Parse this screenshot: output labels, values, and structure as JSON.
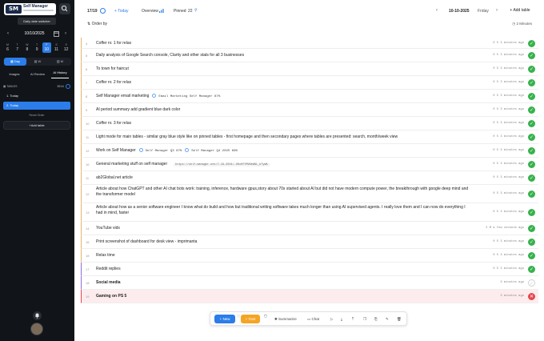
{
  "sidebar": {
    "logo_text": "Self Manager",
    "logo_mark": "SM",
    "tooltip": "Daily date switcher",
    "date": "10/10/2025",
    "days": [
      {
        "dow": "M",
        "num": "6"
      },
      {
        "dow": "T",
        "num": "7"
      },
      {
        "dow": "W",
        "num": "8"
      },
      {
        "dow": "T",
        "num": "9"
      },
      {
        "dow": "F",
        "num": "10"
      },
      {
        "dow": "S",
        "num": "11"
      },
      {
        "dow": "S",
        "num": "12"
      }
    ],
    "selected_day_index": 4,
    "view_tabs": [
      "Day",
      "W",
      "M"
    ],
    "mode_tabs": [
      "Images",
      "AI Review",
      "AI History"
    ],
    "tables_label": "TABLES",
    "tables_count": "38/44",
    "tables": [
      "1. Today",
      "2. Today"
    ],
    "reset_label": "Reset Order",
    "add_table_label": "+Add table"
  },
  "header": {
    "count": "17/19",
    "today": "+ Today",
    "overview": "Overview",
    "pinned_label": "Pinned",
    "pinned_count": "22",
    "date": "10-10-2025",
    "dow": "Friday",
    "add_table": "+ Add table",
    "order_by": "Order by",
    "time_ago": "2 Minutes"
  },
  "rows": [
    {
      "n": "4",
      "title": "Coffer nr. 1 for relax",
      "meta": "0 5   3 minutes ago",
      "status": "done"
    },
    {
      "n": "5",
      "title": "Daily analysis of Google Search console, Clarity and other stats for all 3 businesses",
      "meta": "0 5   3 minutes ago",
      "status": "done"
    },
    {
      "n": "6",
      "title": "To town for haircut",
      "meta": "0 5   3 minutes ago",
      "status": "done"
    },
    {
      "n": "7",
      "title": "Coffer nr. 2 for relax",
      "meta": "0 5   3 minutes ago",
      "status": "done"
    },
    {
      "n": "8",
      "title": "Self Manager email marketing",
      "chip": "Email Marketing Self Manager 87%",
      "meta": "0 5   3 minutes ago",
      "status": "done"
    },
    {
      "n": "9",
      "title": "AI period summary add gradient blue dark color",
      "meta": "0 5   3 minutes ago",
      "status": "done"
    },
    {
      "n": "10",
      "title": "Coffer nr. 3 for relax",
      "meta": "0 5   3 minutes ago",
      "status": "done"
    },
    {
      "n": "11",
      "title": "Light mode for main tables - similar gray blue style like on pinned tables - first homepage and then secondary pages where tables are presented: search, month/week view",
      "meta": "0 5   3 minutes ago",
      "status": "done"
    },
    {
      "n": "12",
      "title": "Work on Self Manager",
      "chip": "Self Manager Q3 67%",
      "chip2": "Self Manager Q4 2025 69%",
      "meta": "0 5   3 minutes ago",
      "status": "done"
    },
    {
      "n": "16",
      "title": "General marketing stuff on self manager",
      "url": "https://self-manager.net/7-19-2024/-OKx0fYMVNeWNL_bTyWA",
      "meta": "0 5   3 minutes ago",
      "status": "done"
    },
    {
      "n": "11",
      "title": "ab2Global.net article",
      "meta": "0 5   3 minutes ago",
      "status": "done"
    },
    {
      "n": "12",
      "title": "Article about how ChatGPT and other AI chat bots work: training, inference, hardware gpus,story about 70s started about AI but did not have modern compute power, the breakthrough with google deep mind and the transformer model",
      "meta": "0 5   3 minutes ago",
      "status": "done"
    },
    {
      "n": "13",
      "title": "Article about how as a senior software engineer I know what do build and how but traditional writing software takes much longer than using AI supervised agents. I really love them and I can now do everything I had in mind, faster",
      "meta": "0 5   3 minutes ago",
      "status": "done"
    },
    {
      "n": "14",
      "title": "YouTube vids",
      "meta": "2 M   a few seconds ago",
      "status": "done"
    },
    {
      "n": "16",
      "title": "Print screenshot of dashboard for desk view - imprimanta",
      "meta": "0 5   3 minutes ago",
      "status": "done"
    },
    {
      "n": "18",
      "title": "Relax time",
      "meta": "0 5   3 minutes ago",
      "status": "done"
    },
    {
      "n": "17",
      "title": "Reddit replies",
      "meta": "0 5   3 minutes ago",
      "status": "done"
    },
    {
      "n": "18",
      "title": "Social media",
      "meta": "3 minutes ago",
      "status": "open"
    },
    {
      "n": "19",
      "title": "Gaming on PS 5",
      "meta": "3 minutes ago",
      "status": "fail"
    }
  ],
  "toolbar": {
    "new": "New",
    "fast": "Fast",
    "summarize": "Summarize",
    "chat": "Chat"
  },
  "colors": {
    "accent": "#2b7de9",
    "done": "#37b24d",
    "fail": "#e5484d",
    "fast": "#f5a524",
    "sidebar_bg": "#111418"
  }
}
